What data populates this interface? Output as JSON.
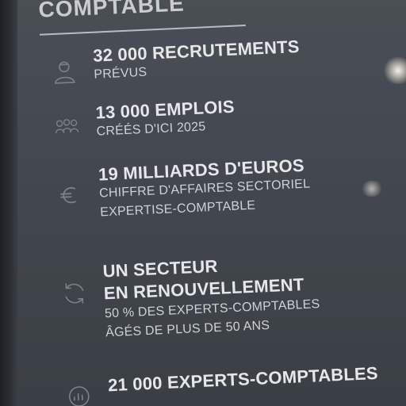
{
  "header": {
    "title": "COMPTABLE"
  },
  "stats": [
    {
      "value": "32 000 RECRUTEMENTS",
      "lines": [
        "PRÉVUS"
      ],
      "icon": "person-icon"
    },
    {
      "value": "13 000 EMPLOIS",
      "lines": [
        "CRÉÉS D'ICI 2025"
      ],
      "icon": "group-icon"
    },
    {
      "value": "19 MILLIARDS D'EUROS",
      "lines": [
        "CHIFFRE D'AFFAIRES SECTORIEL",
        "EXPERTISE-COMPTABLE"
      ],
      "icon": "euro-icon"
    },
    {
      "value_lines": [
        "UN SECTEUR",
        "EN RENOUVELLEMENT"
      ],
      "lines": [
        "50 % DES EXPERTS-COMPTABLES",
        "ÂGÉS DE PLUS DE 50 ANS"
      ],
      "icon": "renew-icon"
    },
    {
      "value": "21 000 EXPERTS-COMPTABLES",
      "lines": [],
      "icon": "chart-icon"
    }
  ],
  "colors": {
    "panel": "#444850",
    "text": "#e6e7e9",
    "subtext": "#cfd2d6"
  }
}
